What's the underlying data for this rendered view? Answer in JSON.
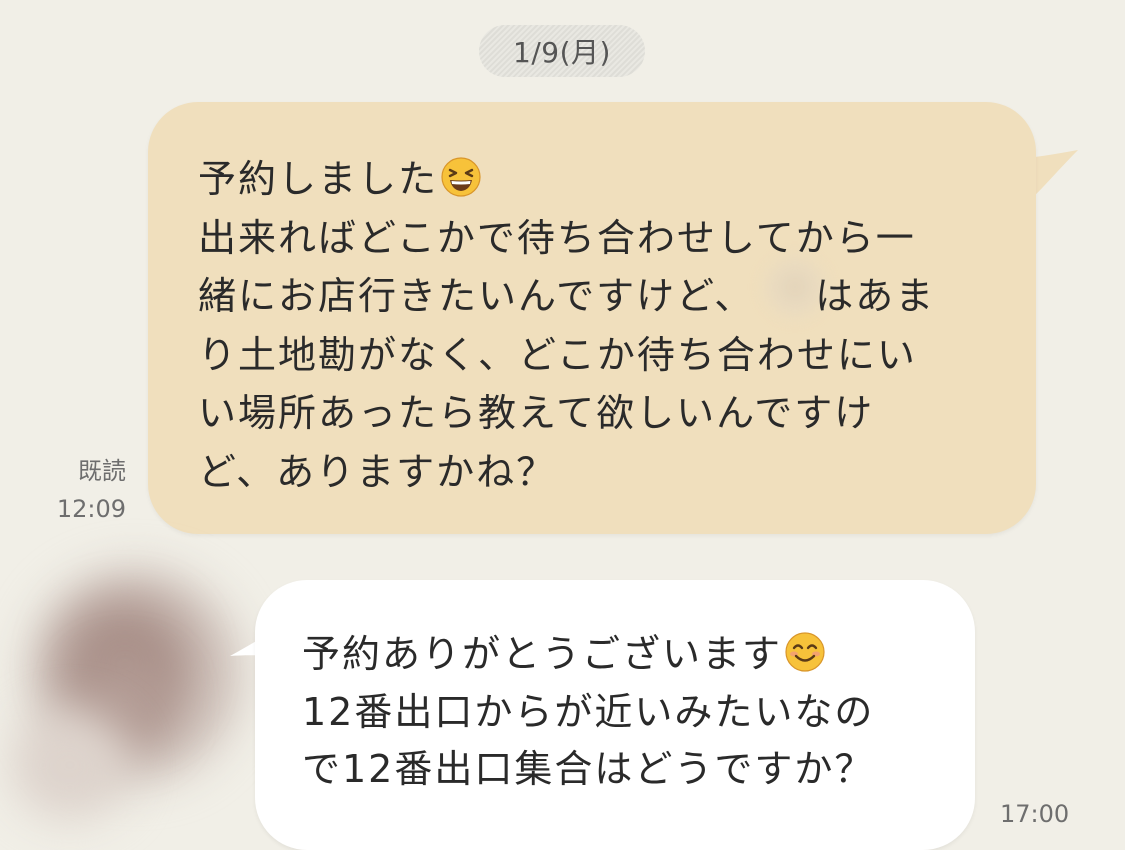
{
  "date_label": "1/9(月)",
  "sent_message": {
    "lines": [
      "予約しました",
      "出来ればどこかで待ち合わせしてから一",
      "緒にお店行きたいんですけど、　　はあま",
      "り土地勘がなく、どこか待ち合わせにい",
      "い場所あったら教えて欲しいんですけ",
      "ど、ありますかね？"
    ],
    "emoji": "grinning-squinting-face",
    "read_label": "既読",
    "time": "12:09",
    "bubble_color": "#f0dfbd"
  },
  "received_message": {
    "lines": [
      "予約ありがとうございます",
      "12番出口からが近いみたいなの",
      "で12番出口集合はどうですか？"
    ],
    "emoji": "smiling-face-with-smiling-eyes",
    "time": "17:00",
    "bubble_color": "#ffffff"
  },
  "background_color": "#f1efe7"
}
